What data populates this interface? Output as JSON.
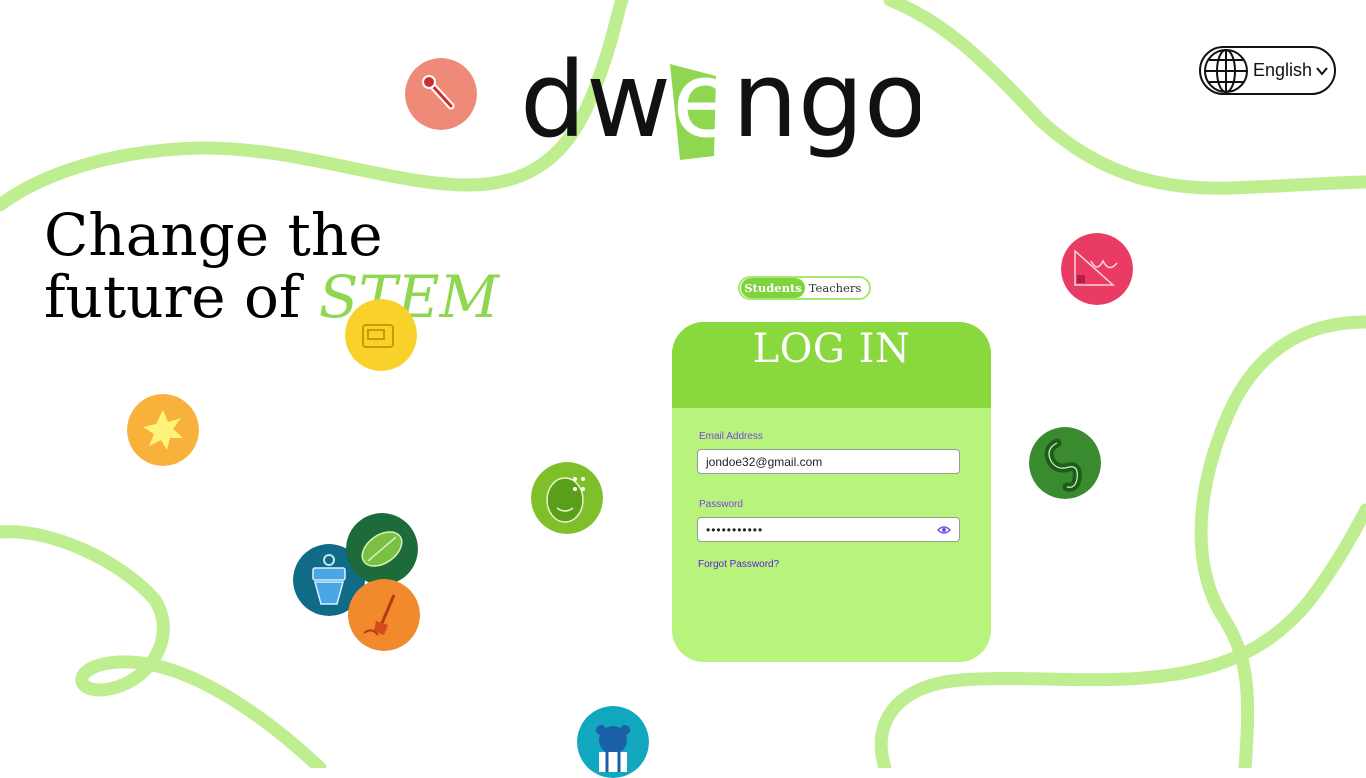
{
  "brand": {
    "logo_text": "dwengo"
  },
  "language": {
    "selected": "English"
  },
  "tagline": {
    "line1": "Change the",
    "line2_prefix": "future of ",
    "line2_accent": "STEM"
  },
  "role_toggle": {
    "students_label": "Students",
    "teachers_label": "Teachers",
    "active": "Students"
  },
  "login": {
    "title": "LOG IN",
    "email_label": "Email Address",
    "email_value": "jondoe32@gmail.com",
    "password_label": "Password",
    "password_mask": "•••••••••••",
    "forgot_label": "Forgot Password?"
  },
  "colors": {
    "accent_green": "#88d83e",
    "card_green": "#b8f47c",
    "squiggle_green": "#bfee91",
    "label_purple": "#7b45e0",
    "link_purple": "#5a22d8"
  },
  "decorative_badges": [
    "thermometer-icon",
    "calculator-icon",
    "splash-icon",
    "brain-face-icon",
    "robot-plant-icon",
    "seed-icon",
    "shovel-icon",
    "graph-triangle-icon",
    "worm-icon",
    "robot-bear-icon"
  ]
}
